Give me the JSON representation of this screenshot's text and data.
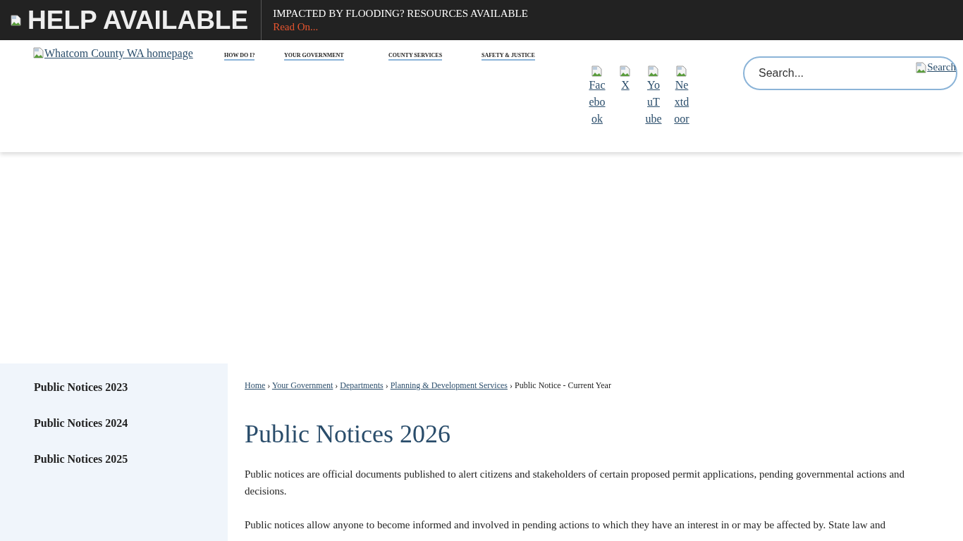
{
  "alert_bar": {
    "heading": "HELP AVAILABLE",
    "title": "IMPACTED BY FLOODING? RESOURCES AVAILABLE",
    "link": "Read On..."
  },
  "header": {
    "logo_alt": "Whatcom County WA homepage",
    "nav": [
      "HOW DO I?",
      "YOUR GOVERNMENT",
      "COUNTY SERVICES",
      "SAFETY & JUSTICE"
    ],
    "social": [
      "Facebook",
      "X",
      "YouTube",
      "Nextdoor"
    ],
    "search": {
      "placeholder": "Search...",
      "button": "Search"
    }
  },
  "sidebar": {
    "items": [
      "Public Notices 2023",
      "Public Notices 2024",
      "Public Notices 2025"
    ]
  },
  "breadcrumb": {
    "links": [
      "Home",
      "Your Government",
      "Departments",
      "Planning & Development Services"
    ],
    "current": "Public Notice - Current Year",
    "separator": "›"
  },
  "page_title": "Public Notices 2026",
  "paragraphs": [
    "Public notices are official documents published to alert citizens and stakeholders of certain proposed permit applications, pending governmental actions and decisions.",
    "Public notices allow anyone to become informed and involved in pending actions to which they have an interest in or may be affected by. State law and"
  ]
}
